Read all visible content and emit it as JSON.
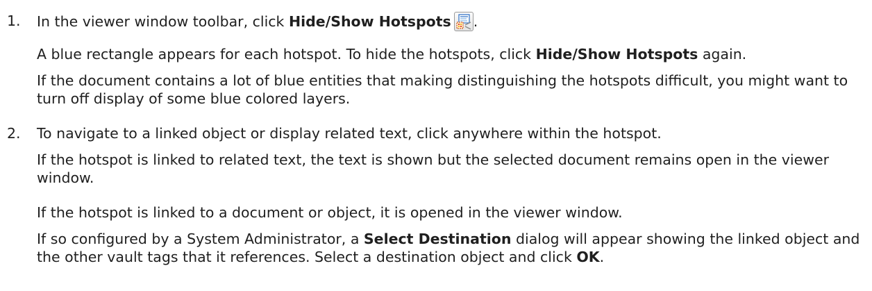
{
  "steps": [
    {
      "number": "1.",
      "instruction": {
        "pre": "In the viewer window toolbar, click ",
        "bold": "Hide/Show Hotspots",
        "post": "."
      },
      "icon": "hide-show-hotspots-icon",
      "notes": [
        {
          "pre": "A blue rectangle appears for each hotspot. To hide the hotspots, click ",
          "bold": "Hide/Show Hotspots",
          "post": " again."
        },
        {
          "text": "If the document contains a lot of blue entities that making distinguishing the hotspots difficult, you might want to turn off display of some blue colored layers."
        }
      ]
    },
    {
      "number": "2.",
      "instruction": "To navigate to a linked object or display related text, click anywhere within the hotspot.",
      "notes": [
        {
          "text": "If the hotspot is linked to related text, the text is shown but the selected document remains open in the viewer window."
        },
        {
          "text": "If the hotspot is linked to a document or object, it is opened in the viewer window."
        },
        {
          "pre": "If so configured by a System Administrator, a ",
          "bold": "Select Destination",
          "mid": " dialog will appear showing the linked object and the other vault tags that it references. Select a destination object and click ",
          "bold2": "OK",
          "post": "."
        }
      ]
    }
  ]
}
